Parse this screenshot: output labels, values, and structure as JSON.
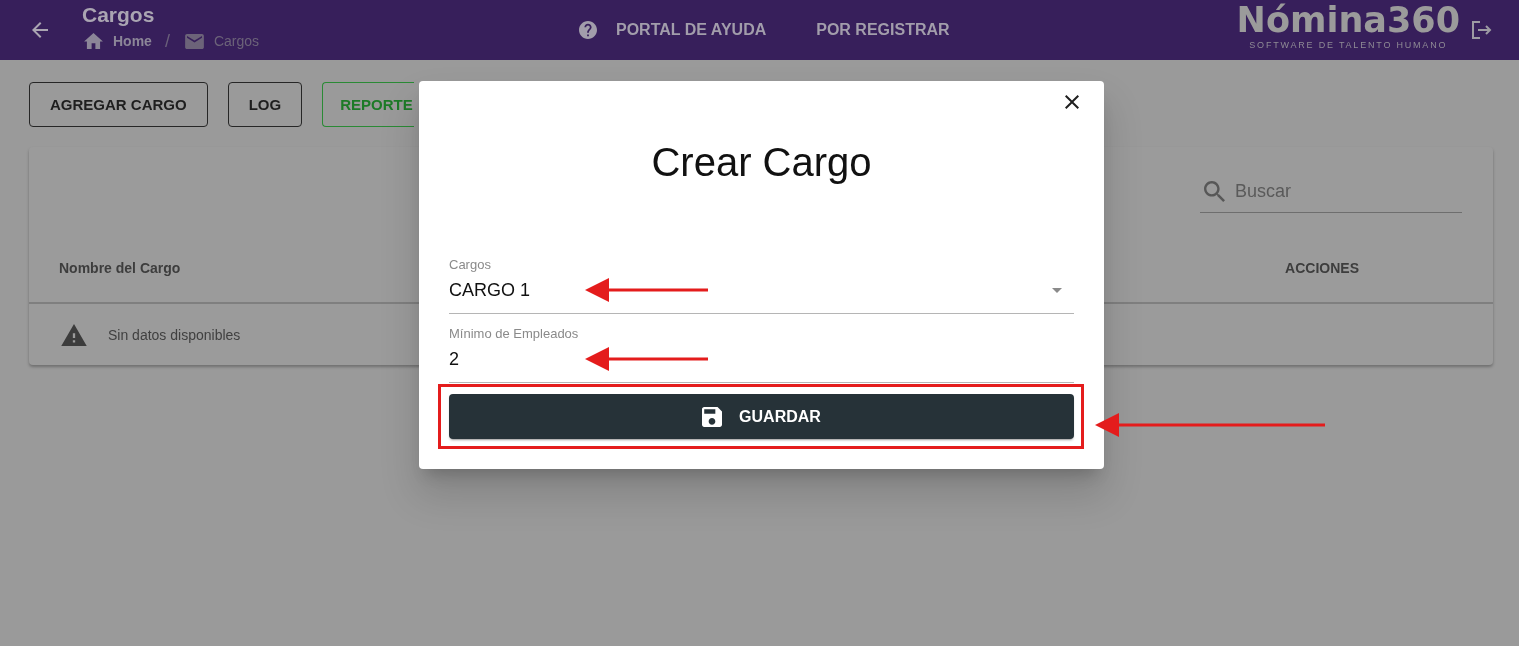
{
  "header": {
    "title": "Cargos",
    "breadcrumbs": [
      {
        "kind": "home",
        "label": "Home",
        "current": false
      },
      {
        "kind": "section",
        "label": "Cargos",
        "current": true
      }
    ],
    "breadcrumb_separator": "/",
    "nav": [
      {
        "kind": "help",
        "label": "PORTAL DE AYUDA"
      },
      {
        "kind": "link",
        "label": "POR REGISTRAR"
      }
    ],
    "logo": {
      "name": "Nómina360",
      "tagline": "SOFTWARE DE TALENTO HUMANO"
    }
  },
  "toolbar": [
    {
      "kind": "default",
      "label": "AGREGAR CARGO"
    },
    {
      "kind": "default",
      "label": "LOG"
    },
    {
      "kind": "success",
      "label": "REPORTE"
    }
  ],
  "table": {
    "search": {
      "placeholder": "Buscar"
    },
    "columns": [
      "Nombre del Cargo",
      "ACCIONES"
    ],
    "empty_message": "Sin datos disponibles"
  },
  "dialog": {
    "title": "Crear Cargo",
    "fields": [
      {
        "kind": "select",
        "label": "Cargos",
        "value": "CARGO 1",
        "annotated": true
      },
      {
        "kind": "input",
        "label": "Mínimo de Empleados",
        "value": "2",
        "annotated": true
      }
    ],
    "submit": {
      "label": "GUARDAR",
      "annotated": true
    }
  }
}
